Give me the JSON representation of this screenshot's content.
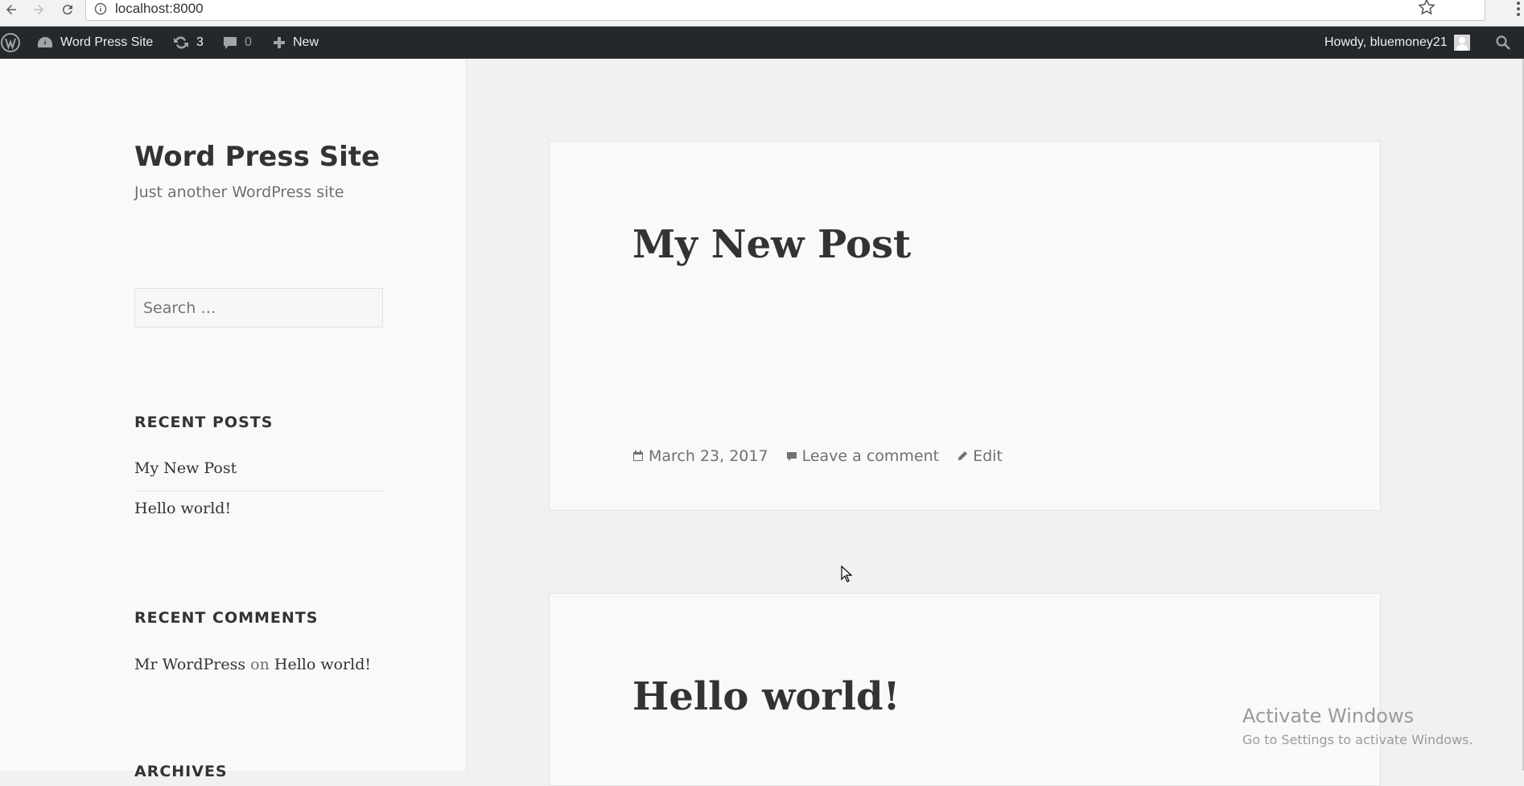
{
  "browser": {
    "url": "localhost:8000"
  },
  "adminbar": {
    "site_name": "Word Press Site",
    "updates_count": "3",
    "comments_count": "0",
    "new_label": "New",
    "greeting": "Howdy, bluemoney21"
  },
  "sidebar": {
    "site_title": "Word Press Site",
    "site_description": "Just another WordPress site",
    "search_placeholder": "Search …",
    "recent_posts_title": "RECENT POSTS",
    "recent_posts": [
      "My New Post",
      "Hello world!"
    ],
    "recent_comments_title": "RECENT COMMENTS",
    "recent_comment": {
      "author": "Mr WordPress",
      "connector": "on",
      "post": "Hello world!"
    },
    "archives_title": "ARCHIVES"
  },
  "posts": [
    {
      "title": "My New Post",
      "date": "March 23, 2017",
      "comment_link": "Leave a comment",
      "edit_link": "Edit"
    },
    {
      "title": "Hello world!"
    }
  ],
  "watermark": {
    "title": "Activate Windows",
    "subtitle": "Go to Settings to activate Windows."
  }
}
